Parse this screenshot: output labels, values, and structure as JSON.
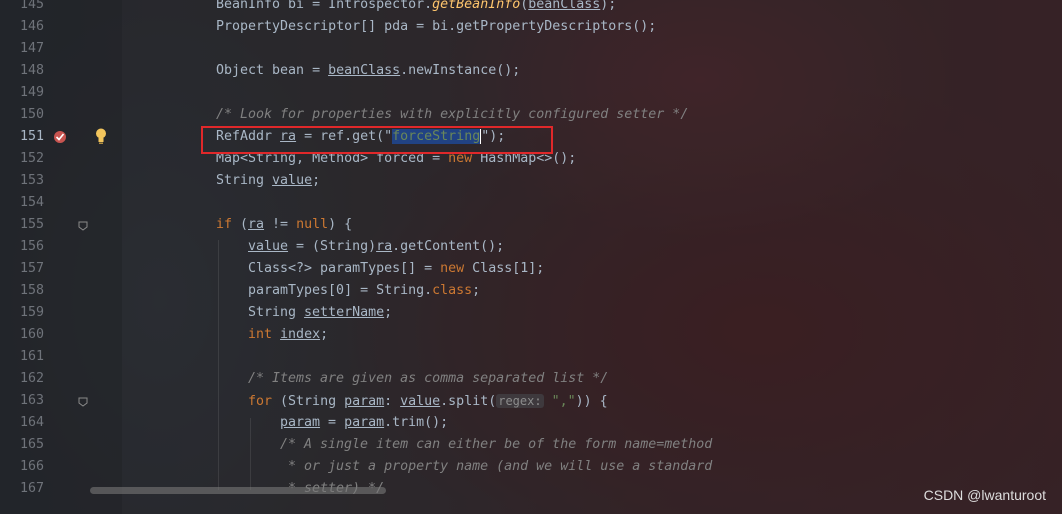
{
  "lines": [
    {
      "n": "145",
      "code": ""
    },
    {
      "n": "146",
      "code": ""
    },
    {
      "n": "147",
      "code": ""
    },
    {
      "n": "148",
      "code": ""
    },
    {
      "n": "149",
      "code": ""
    },
    {
      "n": "150",
      "code": ""
    },
    {
      "n": "151",
      "code": ""
    },
    {
      "n": "152",
      "code": ""
    },
    {
      "n": "153",
      "code": ""
    },
    {
      "n": "154",
      "code": ""
    },
    {
      "n": "155",
      "code": ""
    },
    {
      "n": "156",
      "code": ""
    },
    {
      "n": "157",
      "code": ""
    },
    {
      "n": "158",
      "code": ""
    },
    {
      "n": "159",
      "code": ""
    },
    {
      "n": "160",
      "code": ""
    },
    {
      "n": "161",
      "code": ""
    },
    {
      "n": "162",
      "code": ""
    },
    {
      "n": "163",
      "code": ""
    },
    {
      "n": "164",
      "code": ""
    },
    {
      "n": "165",
      "code": ""
    },
    {
      "n": "166",
      "code": ""
    },
    {
      "n": "167",
      "code": ""
    }
  ],
  "code": {
    "l145": {
      "a": "BeanInfo bi = Introspector.",
      "b": "getBeanInfo",
      "c": "(",
      "d": "beanClass",
      "e": ");"
    },
    "l146": "PropertyDescriptor[] pda = bi.getPropertyDescriptors();",
    "l148": {
      "a": "Object bean = ",
      "b": "beanClass",
      "c": ".newInstance();"
    },
    "l150": "/* Look for properties with explicitly configured setter */",
    "l151": {
      "a": "RefAddr ",
      "b": "ra",
      "c": " = ref.get(\"",
      "d": "forceString",
      "e": "\");"
    },
    "l152": {
      "a": "Map<String, Method> forced = ",
      "kw": "new",
      "b": " HashMap<>();"
    },
    "l153": {
      "a": "String ",
      "b": "value",
      "c": ";"
    },
    "l155": {
      "kw": "if",
      "a": " (",
      "b": "ra",
      "c": " != ",
      "kw2": "null",
      "d": ") {"
    },
    "l156": {
      "a": "value",
      "b": " = (String)",
      "c": "ra",
      "d": ".getContent();"
    },
    "l157": {
      "a": "Class<?> paramTypes[] = ",
      "kw": "new",
      "b": " Class[1];"
    },
    "l158": {
      "a": "paramTypes[0] = String.",
      "kw": "class",
      "b": ";"
    },
    "l159": {
      "a": "String ",
      "b": "setterName",
      "c": ";"
    },
    "l160": {
      "kw": "int",
      "a": " ",
      "b": "index",
      "c": ";"
    },
    "l162": "/* Items are given as comma separated list */",
    "l163": {
      "kw": "for",
      "a": " (String ",
      "b": "param",
      "c": ": ",
      "d": "value",
      "e": ".split(",
      "hint": "regex:",
      "f": "\",\"",
      "g": ")) {"
    },
    "l164": {
      "a": "param",
      "b": " = ",
      "c": "param",
      "d": ".trim();"
    },
    "l165": "/* A single item can either be of the form name=method",
    "l166": " * or just a property name (and we will use a standard",
    "l167": " * setter) */"
  },
  "watermark": "CSDN @lwanturoot",
  "colors": {
    "keyword": "#cc7832",
    "comment": "#808080",
    "string": "#6a8759",
    "highlight": "#e0282a",
    "selection": "#214283"
  },
  "icons": [
    "breakpoint-icon",
    "bulb-icon",
    "fold-icon"
  ]
}
